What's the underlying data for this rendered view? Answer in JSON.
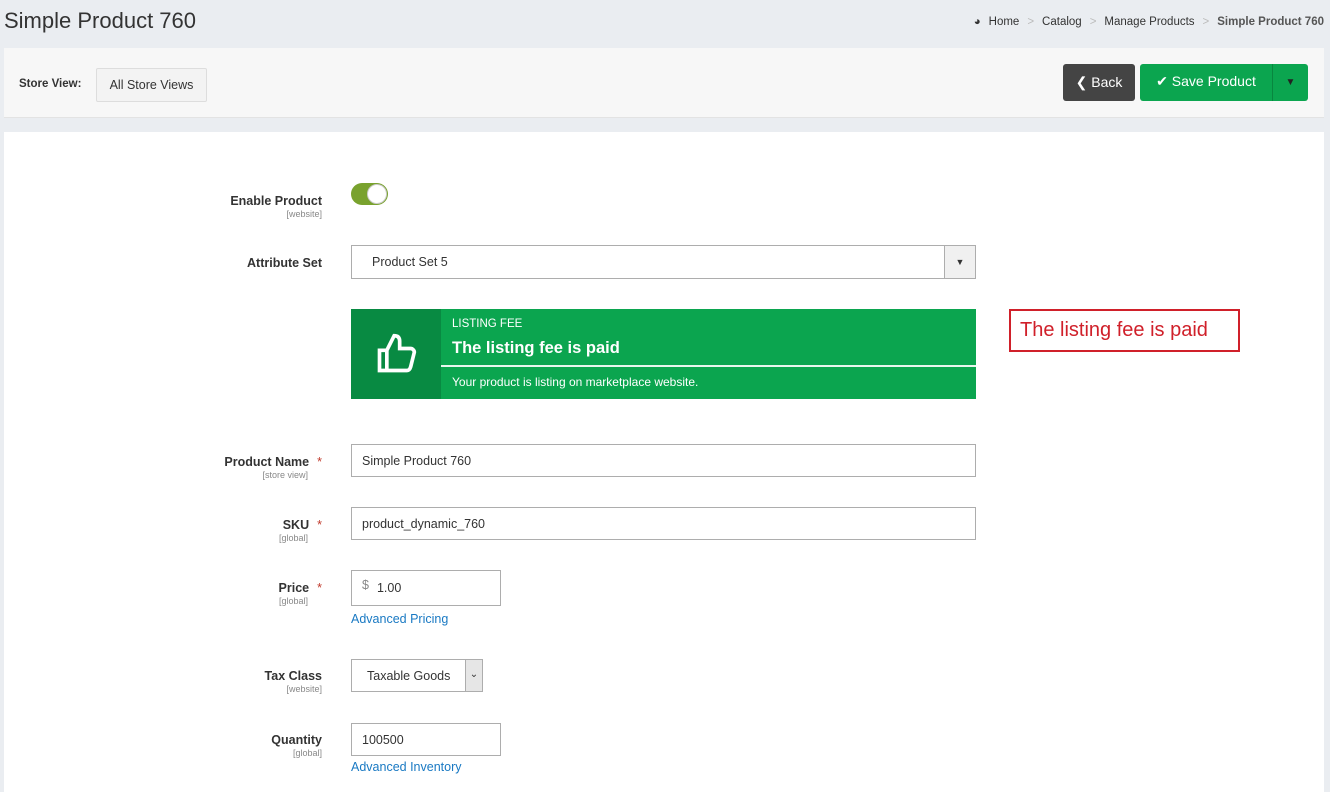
{
  "header": {
    "title": "Simple Product 760",
    "breadcrumb": [
      "Home",
      "Catalog",
      "Manage Products",
      "Simple Product 760"
    ],
    "breadcrumb_icon": "dashboard-icon"
  },
  "toolbar": {
    "store_view_label": "Store View:",
    "store_view_value": "All Store Views",
    "back_label": "Back",
    "save_label": "Save Product"
  },
  "form": {
    "enable_product": {
      "label": "Enable Product",
      "scope": "[website]",
      "enabled": true
    },
    "attribute_set": {
      "label": "Attribute Set",
      "value": "Product Set 5"
    },
    "listing_fee": {
      "caption": "LISTING FEE",
      "heading": "The listing fee is paid",
      "message": "Your product is listing on marketplace website.",
      "icon": "thumbs-up-icon"
    },
    "annotation": "The listing fee is paid",
    "product_name": {
      "label": "Product Name",
      "scope": "[store view]",
      "value": "Simple Product 760",
      "required": "*"
    },
    "sku": {
      "label": "SKU",
      "scope": "[global]",
      "value": "product_dynamic_760",
      "required": "*"
    },
    "price": {
      "label": "Price",
      "scope": "[global]",
      "currency": "$",
      "value": "1.00",
      "required": "*",
      "link": "Advanced Pricing"
    },
    "tax_class": {
      "label": "Tax Class",
      "scope": "[website]",
      "value": "Taxable Goods"
    },
    "quantity": {
      "label": "Quantity",
      "scope": "[global]",
      "value": "100500",
      "link": "Advanced Inventory"
    }
  },
  "colors": {
    "accent": "#0ba54f",
    "toggle_on": "#79a22e",
    "annotation": "#d0202a",
    "link": "#1979c3"
  }
}
